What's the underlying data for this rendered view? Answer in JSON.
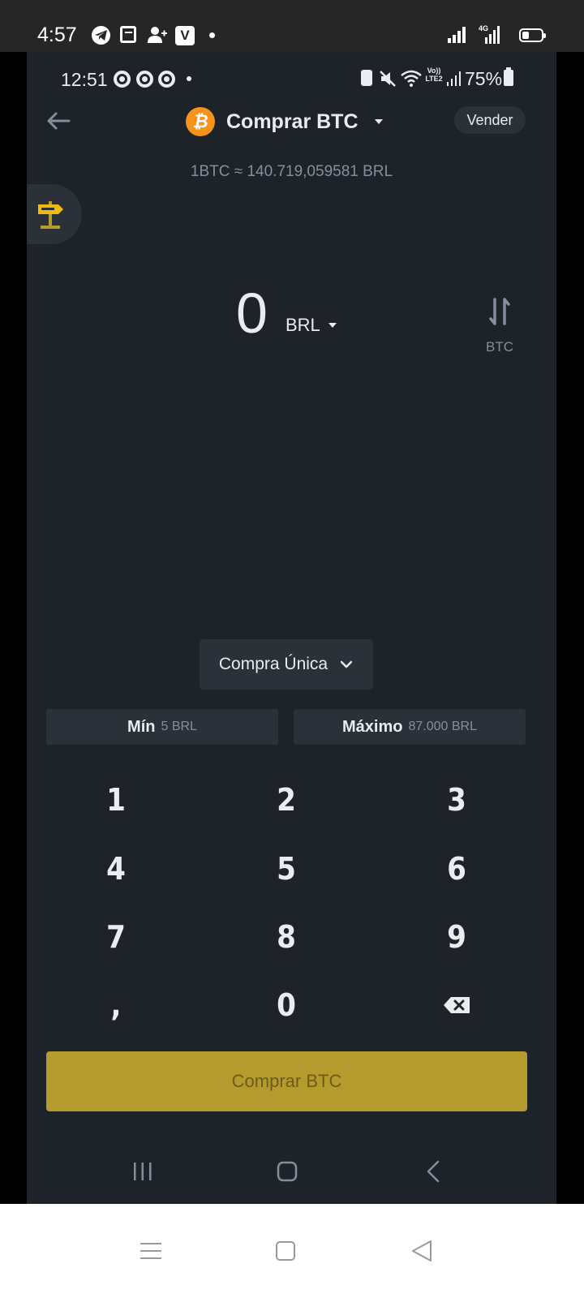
{
  "outer_status": {
    "time": "4:57",
    "network": "4G"
  },
  "inner_status": {
    "time": "12:51",
    "volte": "Vo)) LTE2",
    "battery": "75%"
  },
  "header": {
    "title": "Comprar BTC",
    "coin_logo": "₿",
    "sell_label": "Vender"
  },
  "rate_text": "1BTC ≈ 140.719,059581 BRL",
  "amount": {
    "value": "0",
    "currency": "BRL",
    "swap_label": "BTC"
  },
  "purchase_type": "Compra Única",
  "limits": {
    "min_label": "Mín",
    "min_value": "5 BRL",
    "max_label": "Máximo",
    "max_value": "87.000 BRL"
  },
  "keypad": [
    "1",
    "2",
    "3",
    "4",
    "5",
    "6",
    "7",
    "8",
    "9",
    ",",
    "0"
  ],
  "buy_button": "Comprar BTC",
  "colors": {
    "background": "#1e2329",
    "surface": "#2b3139",
    "accent": "#b59a2d",
    "bitcoin": "#f7931a",
    "muted": "#848e9c"
  },
  "icons": [
    "back-arrow-icon",
    "bitcoin-icon",
    "signpost-icon",
    "swap-icon",
    "chevron-down-icon",
    "backspace-icon",
    "recents-icon",
    "home-icon",
    "back-icon"
  ]
}
